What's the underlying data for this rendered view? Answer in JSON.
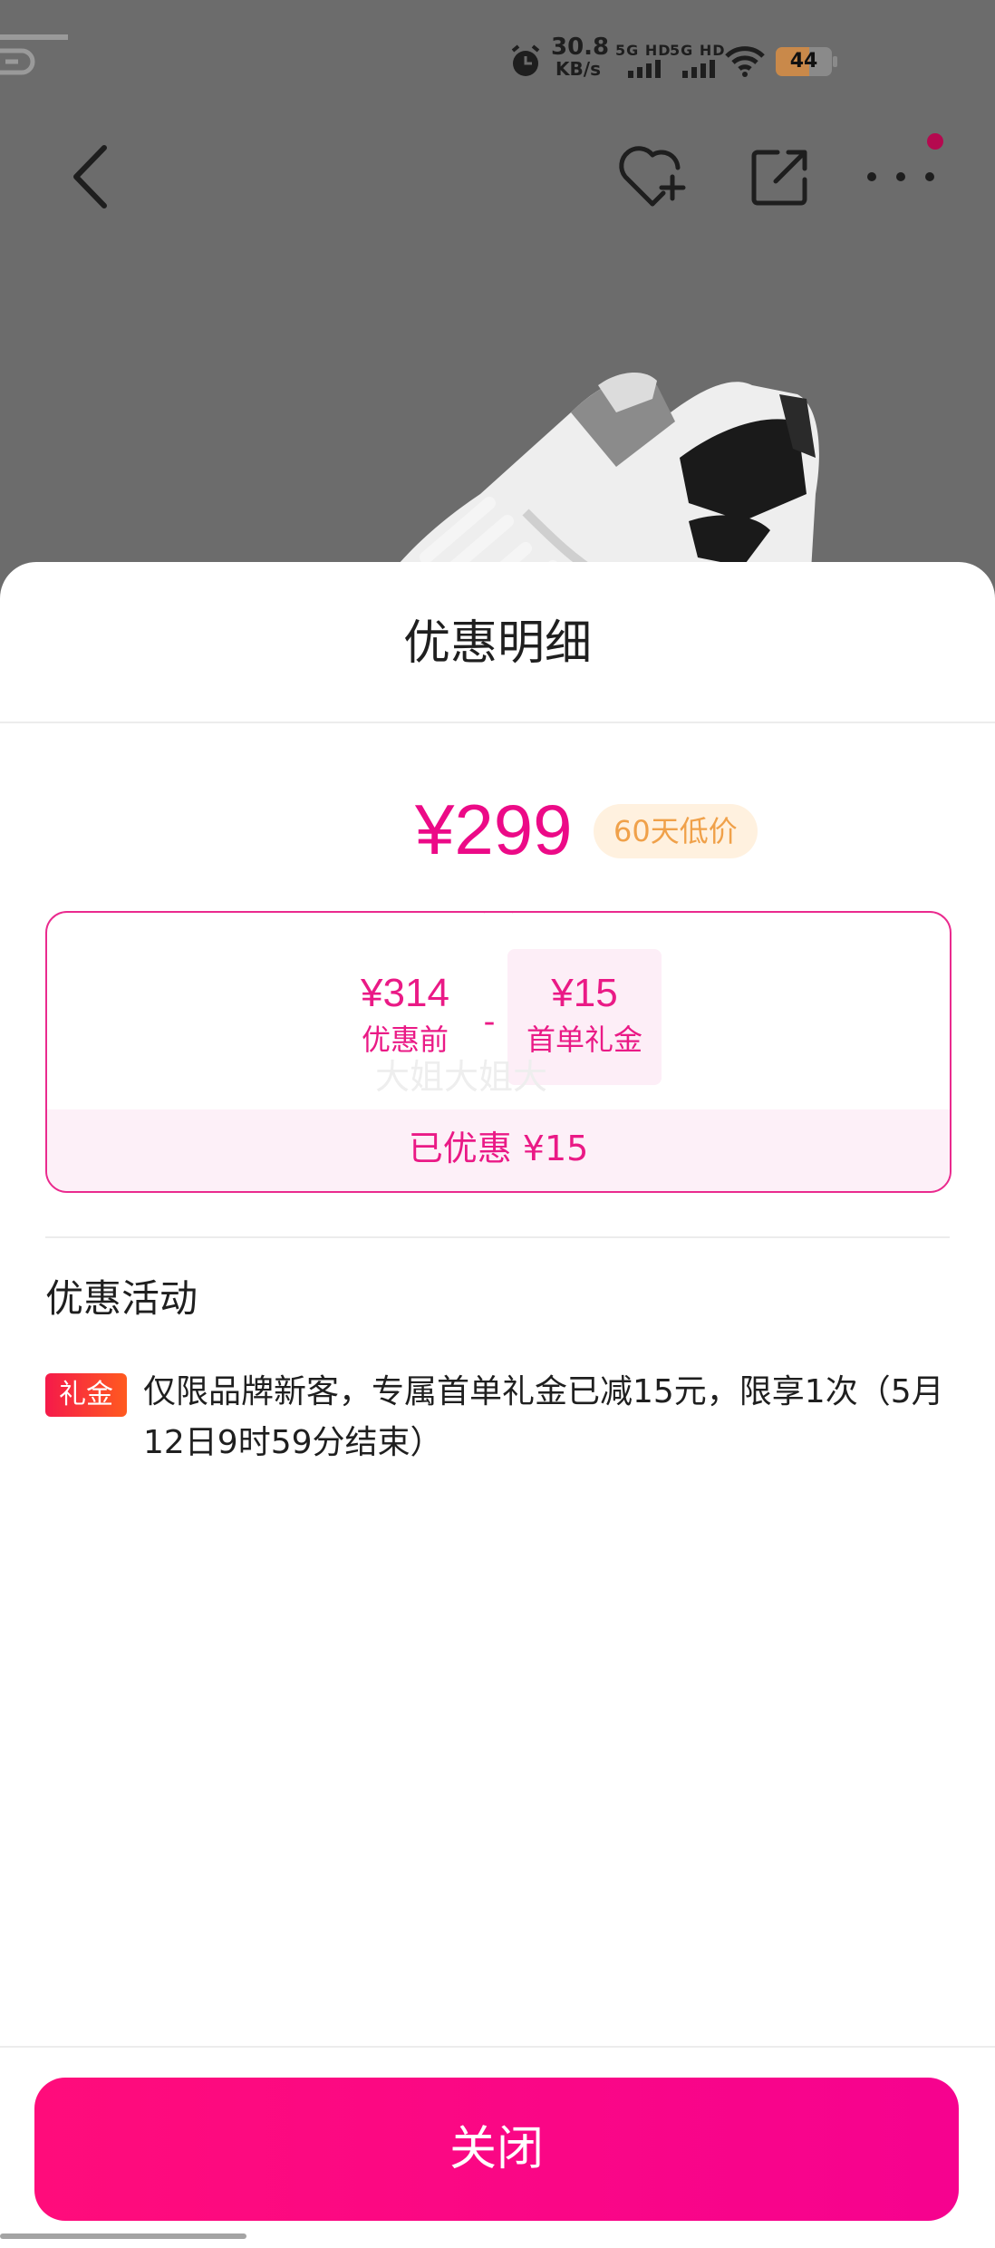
{
  "status_bar": {
    "speed_value": "30.8",
    "speed_unit": "KB/s",
    "sim1_label": "5G HD",
    "sim2_label": "5G HD",
    "battery": "44"
  },
  "nav": {
    "back_icon": "chevron-left-icon",
    "favorite_icon": "heart-plus-icon",
    "share_icon": "share-icon",
    "more_icon": "more-icon"
  },
  "sheet": {
    "title": "优惠明细",
    "final_price": "¥299",
    "low_price_tag": "60天低价",
    "original_price": "¥314",
    "original_label": "优惠前",
    "operator": "-",
    "coupon_amount": "¥15",
    "coupon_label": "首单礼金",
    "watermark": "大姐大姐大",
    "saved_text": "已优惠 ¥15",
    "section_title": "优惠活动",
    "promo_tag": "礼金",
    "promo_text": "仅限品牌新客，专属首单礼金已减15元，限享1次（5月12日9时59分结束）",
    "close_button": "关闭"
  },
  "colors": {
    "accent": "#ec0a87",
    "tag_bg": "#fff1df",
    "tag_text": "#f0a14a",
    "button_start": "#ff0c7b",
    "button_end": "#f6028f"
  }
}
